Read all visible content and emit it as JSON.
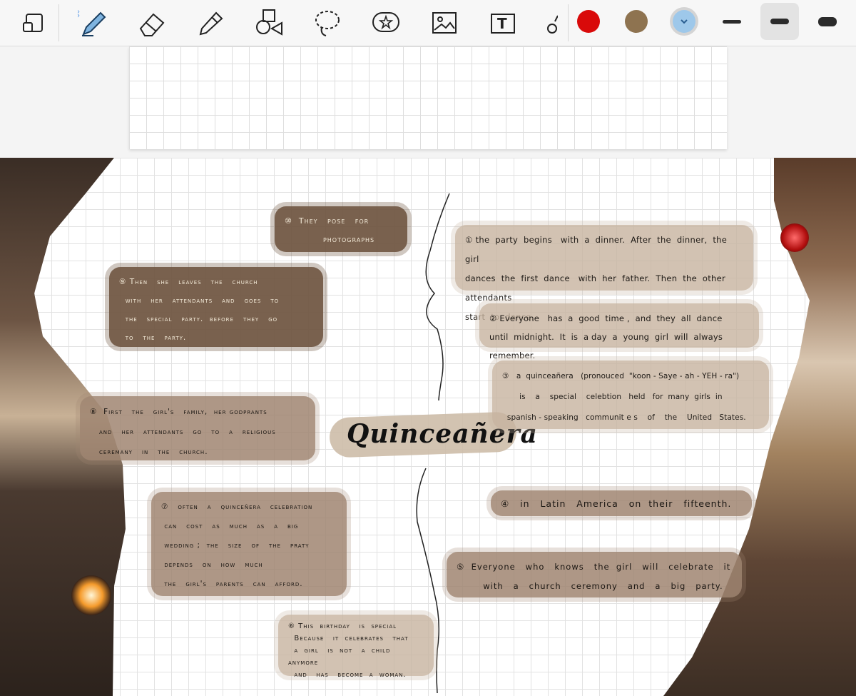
{
  "toolbar": {
    "tools": [
      {
        "name": "page-view-icon"
      },
      {
        "name": "pen-icon",
        "bluetooth": true
      },
      {
        "name": "eraser-icon"
      },
      {
        "name": "highlighter-icon"
      },
      {
        "name": "shapes-icon"
      },
      {
        "name": "lasso-icon"
      },
      {
        "name": "elements-icon"
      },
      {
        "name": "image-icon"
      },
      {
        "name": "text-icon"
      },
      {
        "name": "laser-icon"
      }
    ],
    "colors": [
      "#d90a0a",
      "#8e7350",
      "#9ec8ea"
    ],
    "selected_color_index": 2,
    "widths": [
      "thin",
      "medium",
      "thick"
    ],
    "selected_width_index": 1
  },
  "title": "Quinceañera",
  "notes": {
    "n10": "⑩  They   pose   for\n            photographs",
    "n9": "⑨ Then   she   leaves   the   church\n  with   her   attendants   and   goes   to\n  the   special   party.  before   they   go\n  to   the   party.",
    "n8": "⑧  First   the   girl's   family,  her godprants\n   and   her   attendants   go   to   a   religious\n   ceremany   in   the   church.",
    "n7": "⑦   often   a   quinceñera   celebration\n can   cost   as   much   as   a   big\n wedding ;  the   size   of   the   praty\n depends   on   how   much\n the   girl's   parents   can   afford.",
    "n6": "⑥ This  birthday   is  special\n  Because   it  celebrates   that\n  a  girl   is  not   a  child  anymore\n  and   has   become  a  woman.",
    "n1": "① the  party  begins   with  a  dinner.  After  the  dinner,  the  girl\ndances  the  first  dance   with  her  father.  Then  the  other  attendants\nstart  to  dance.",
    "n2": "② Everyone   has  a  good  time ,  and  they  all  dance\nuntil  midnight.  It  is  a day  a  young  girl  will  always  remember.",
    "n3": "③   a  quinceañera   (pronouced  \"koon - Saye - ah - YEH - ra\")\n       is    a    special    celebtion   held   for  many  girls  in\n  spanish - speaking   communit e s    of    the    United   States.",
    "n4": "④   in   Latin   America   on  their   fifteenth.",
    "n5": "⑤  Everyone   who   knows   the  girl   will   celebrate   it\n        with   a   church   ceremony   and   a   big   party."
  }
}
